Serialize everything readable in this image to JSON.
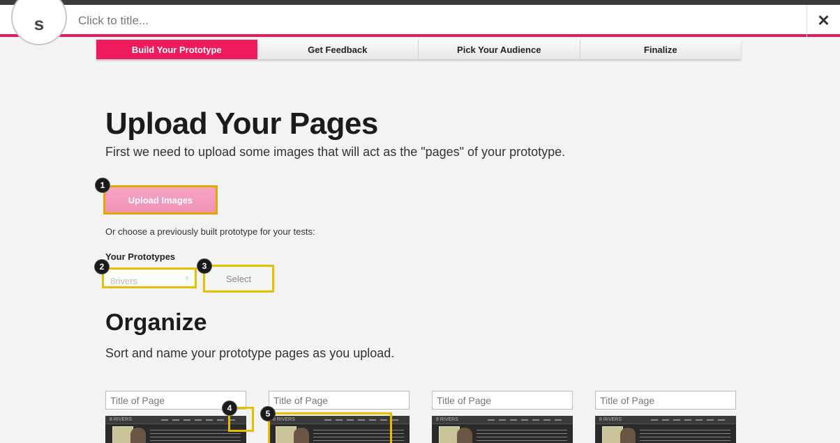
{
  "header": {
    "logo_letter": "s",
    "title_placeholder": "Click to title...",
    "close_symbol": "✕"
  },
  "steps": [
    {
      "label": "Build Your Prototype",
      "active": true
    },
    {
      "label": "Get Feedback",
      "active": false
    },
    {
      "label": "Pick Your Audience",
      "active": false
    },
    {
      "label": "Finalize",
      "active": false
    }
  ],
  "upload": {
    "heading": "Upload Your Pages",
    "description": "First we need to upload some images that will act as the \"pages\" of your prototype.",
    "button_label": "Upload Images",
    "or_text": "Or choose a previously built prototype for your tests:",
    "prototypes_label": "Your Prototypes",
    "selected_prototype": "8rivers",
    "select_button_label": "Select"
  },
  "organize": {
    "heading": "Organize",
    "description": "Sort and name your prototype pages as you upload.",
    "page_title_placeholder": "Title of Page",
    "thumbnail_brand": "8 RIVERS"
  },
  "badges": [
    "1",
    "2",
    "3",
    "4",
    "5"
  ],
  "colors": {
    "accent": "#ee1b5f",
    "highlight": "#e6c000",
    "topbar": "#3c3c3c"
  }
}
